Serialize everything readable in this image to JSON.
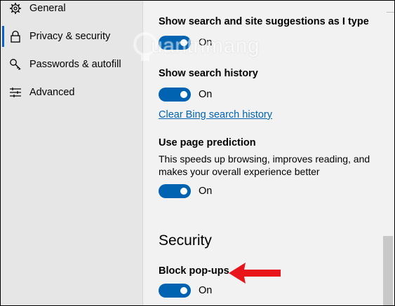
{
  "sidebar": {
    "items": [
      {
        "label": "General",
        "icon": "gear-icon",
        "active": false
      },
      {
        "label": "Privacy & security",
        "icon": "lock-icon",
        "active": true
      },
      {
        "label": "Passwords & autofill",
        "icon": "key-icon",
        "active": false
      },
      {
        "label": "Advanced",
        "icon": "sliders-icon",
        "active": false
      }
    ]
  },
  "content": {
    "suggestions": {
      "label": "Show search and site suggestions as I type",
      "state": "On"
    },
    "history": {
      "label": "Show search history",
      "state": "On",
      "clear_link": "Clear Bing search history"
    },
    "prediction": {
      "label": "Use page prediction",
      "description": "This speeds up browsing, improves reading, and makes your overall experience better",
      "state": "On"
    },
    "security_title": "Security",
    "popups": {
      "label": "Block pop-ups",
      "state": "On"
    }
  },
  "watermark": {
    "text": "uantrimang"
  },
  "colors": {
    "accent": "#0063b1",
    "link": "#0063b1",
    "arrow": "#e8141a",
    "sidebar_bg": "#e6e6e6",
    "content_bg": "#f2f2f2"
  }
}
